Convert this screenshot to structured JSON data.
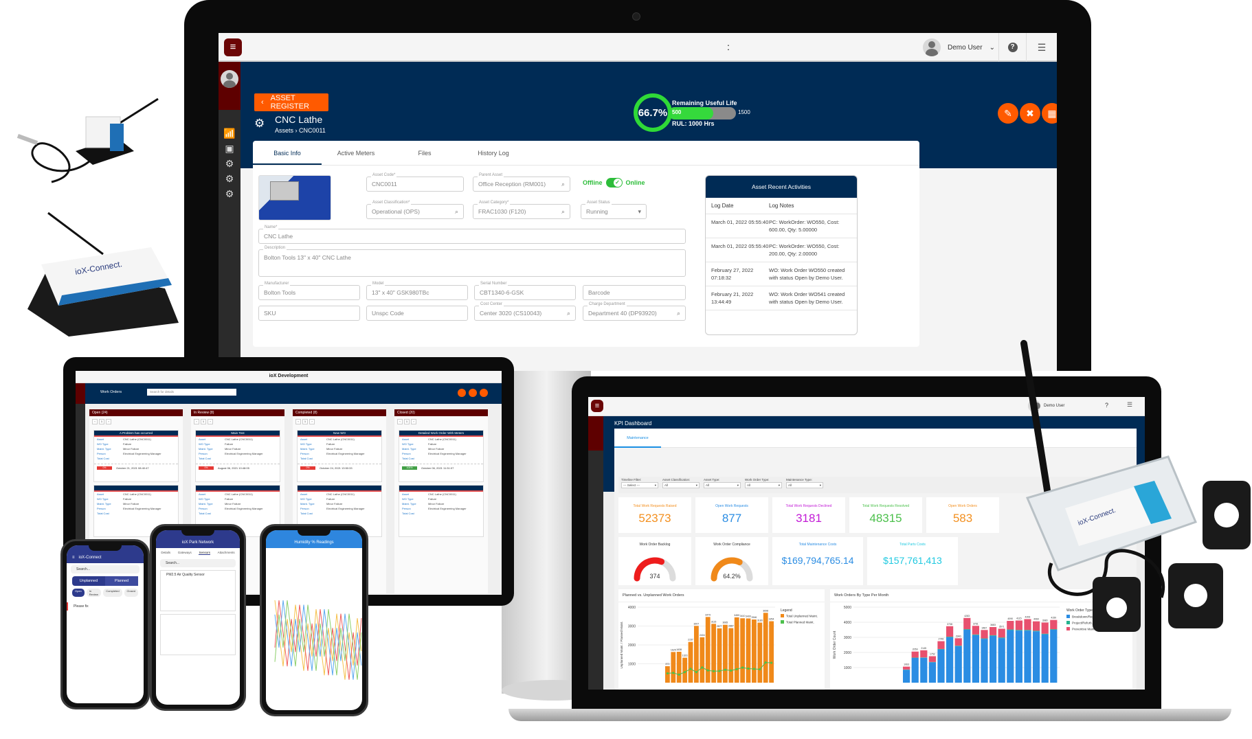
{
  "monitor": {
    "topbar": {
      "center_mark": ":",
      "user_name": "Demo User",
      "help_icon": "?",
      "menu_icon": "☰"
    },
    "back_button": "ASSET REGISTER",
    "asset": {
      "title": "CNC Lathe",
      "breadcrumb_root": "Assets",
      "breadcrumb_sep": "›",
      "breadcrumb_leaf": "CNC0011"
    },
    "rul": {
      "percent_label": "66.7%",
      "percent": 66.7,
      "title": "Remaining Useful Life",
      "min": "500",
      "max": "1500",
      "fill_fraction": 0.6667,
      "rul_text": "RUL: 1000 Hrs"
    },
    "tabs": [
      "Basic Info",
      "Active Meters",
      "Files",
      "History Log"
    ],
    "active_tab": "Basic Info",
    "form": {
      "asset_code": {
        "label": "Asset Code*",
        "value": "CNC0011"
      },
      "parent_asset": {
        "label": "Parent Asset",
        "value": "Office Reception  (RM001)"
      },
      "status_toggle": {
        "off_label": "Offline",
        "on_label": "Online",
        "state": "Online"
      },
      "asset_classification": {
        "label": "Asset Classification*",
        "value": "Operational (OPS)"
      },
      "asset_category": {
        "label": "Asset Category*",
        "value": "FRAC1030 (F120)"
      },
      "asset_status": {
        "label": "Asset Status",
        "value": "Running"
      },
      "name": {
        "label": "Name*",
        "value": "CNC Lathe"
      },
      "description": {
        "label": "Description",
        "value": "Bolton Tools 13\" x 40\" CNC Lathe"
      },
      "manufacturer": {
        "label": "Manufacturer",
        "value": "Bolton Tools"
      },
      "model": {
        "label": "Model",
        "value": "13\" x 40\" GSK980TBc"
      },
      "serial_number": {
        "label": "Serial Number",
        "value": "CBT1340-6-GSK"
      },
      "barcode": {
        "placeholder": "Barcode"
      },
      "sku": {
        "placeholder": "SKU"
      },
      "unspc_code": {
        "placeholder": "Unspc Code"
      },
      "cost_center": {
        "label": "Cost Center",
        "value": "Center 3020 (CS10043)"
      },
      "charge_department": {
        "label": "Charge Department",
        "value": "Department 40 (DP93920)"
      }
    },
    "activities": {
      "title": "Asset Recent Activities",
      "headers": [
        "Log Date",
        "Log Notes"
      ],
      "rows": [
        {
          "date": "March 01, 2022 05:55:40",
          "note": "PC: WorkOrder: WO550, Cost: 600.00, Qty: 5.00000"
        },
        {
          "date": "March 01, 2022 05:55:40",
          "note": "PC: WorkOrder: WO550, Cost: 200.00, Qty: 2.00000"
        },
        {
          "date": "February 27, 2022 07:18:32",
          "note": "WO: Work Order WO550 created with status Open by Demo User."
        },
        {
          "date": "February 21, 2022 13:44:49",
          "note": "WO: Work Order WO541 created with status Open by Demo User."
        }
      ]
    }
  },
  "tablet": {
    "title": "ioX Development",
    "section": "Work Orders",
    "search_placeholder": "Search for details",
    "columns": [
      {
        "title": "Open (24)",
        "card": "A Problem has occurred",
        "pill": "0%",
        "pill_color": "#e53935",
        "date": "October 21, 2021 08:40:47"
      },
      {
        "title": "In Review (8)",
        "card": "Main Test",
        "pill": "0%",
        "pill_color": "#e53935",
        "date": "August 06, 2021 10:48:05"
      },
      {
        "title": "Completed (8)",
        "card": "New WO",
        "pill": "0%",
        "pill_color": "#e53935",
        "date": "October 24, 2021 13:50:33"
      },
      {
        "title": "Closed (20)",
        "card": "Detailed Work Order With Meters",
        "pill": "100%",
        "pill_color": "#43a047",
        "date": "October 06, 2021 11:31:07"
      }
    ],
    "card_fields": [
      "Asset",
      "WO Type",
      "Maint. Type",
      "Person",
      "Total Cost"
    ],
    "card_values": [
      "CNC Lathe (CNC0011)",
      "Failure",
      "Minor Failure",
      "Electrical Engineering Manager"
    ]
  },
  "phones": [
    {
      "app": "ioX-Connect",
      "search": "Search...",
      "segments": [
        "Unplanned",
        "Planned"
      ],
      "chips": [
        "Open",
        "In Review",
        "Completed",
        "Closed"
      ],
      "item": "Please fix"
    },
    {
      "app": "ioX Park Network",
      "tabs": [
        "Details",
        "Gateways",
        "Sensors",
        "Attachments"
      ],
      "search": "Search...",
      "sensor_name": "PM2.5 Air Quality Sensor"
    },
    {
      "app": "Humidity % Readings"
    }
  ],
  "laptop": {
    "user_name": "Demo User",
    "title": "KPI Dashboard",
    "tab": "Maintenance",
    "filters": [
      {
        "label": "Timeline Filter:",
        "value": "--- Select ---"
      },
      {
        "label": "Asset Classification:",
        "value": "All"
      },
      {
        "label": "Asset Type:",
        "value": "All"
      },
      {
        "label": "Work Order Type:",
        "value": "All"
      },
      {
        "label": "Maintenance Type:",
        "value": "All"
      }
    ],
    "kpis": [
      {
        "title": "Total Work Requests Raised",
        "value": "52373",
        "color": "#f39020"
      },
      {
        "title": "Open Work Requests",
        "value": "877",
        "color": "#2b8de3"
      },
      {
        "title": "Total Work Requests Declined",
        "value": "3181",
        "color": "#c21bd6"
      },
      {
        "title": "Total Work Requests Resolved",
        "value": "48315",
        "color": "#4cc04c"
      },
      {
        "title": "Open Work Orders",
        "value": "583",
        "color": "#f39020"
      }
    ],
    "gauges": [
      {
        "title": "Work Order Backlog",
        "value": "374",
        "fraction": 0.62,
        "color": "#ee1c1c"
      },
      {
        "title": "Work Order Compliance",
        "value": "64.2%",
        "fraction": 0.642,
        "color": "#f0891a"
      }
    ],
    "costs": [
      {
        "title": "Total Maintenance Costs",
        "value": "$169,794,765.14",
        "color": "#2b8de3"
      },
      {
        "title": "Total Parts Costs",
        "value": "$157,761,413",
        "color": "#1fc9e0"
      }
    ]
  },
  "chart_data": [
    {
      "type": "bar",
      "title": "Planned vs. Unplanned Work Orders",
      "ylabel": "Unplanned Maint. / Planned Maint.",
      "ylim": [
        0,
        4000
      ],
      "yticks": [
        1000,
        2000,
        3000,
        4000
      ],
      "legend_title": "Legend",
      "legend_position": "top-right",
      "series": [
        {
          "name": "Total Unplanned Maint.",
          "kind": "bar",
          "color": "#f0891a",
          "values": [
            873,
            1625,
            1638,
            1323,
            2157,
            3007,
            2404,
            3479,
            3115,
            2877,
            3065,
            2887,
            3459,
            3410,
            3400,
            3346,
            3180,
            3698,
            3254
          ]
        },
        {
          "name": "Total Planned Maint.",
          "kind": "line",
          "color": "#4cc04c",
          "values": [
            494,
            520,
            429,
            560,
            731,
            560,
            804,
            650,
            610,
            619,
            684,
            640,
            715,
            800,
            745,
            727,
            707,
            1067,
            1053
          ]
        }
      ]
    },
    {
      "type": "bar",
      "stacked": true,
      "title": "Work Orders By Type Per Month",
      "ylabel": "Work Order Count",
      "ylim": [
        0,
        5000
      ],
      "yticks": [
        1000,
        2000,
        3000,
        4000,
        5000
      ],
      "legend_title": "Work Order Types",
      "legend_position": "right",
      "legend_entries": [
        "Breakdown/Repair Or...",
        "Project/Refurb...",
        "Preventive Maintenan..."
      ],
      "totals": [
        1063,
        2059,
        2145,
        1752,
        2746,
        3738,
        2940,
        4283,
        3761,
        3487,
        3683,
        3571,
        4090,
        4115,
        4206,
        4060,
        3980,
        4150
      ],
      "series": [
        {
          "name": "Breakdown",
          "color": "#2b8de3",
          "values": [
            850,
            1640,
            1650,
            1350,
            2200,
            3000,
            2420,
            3500,
            3150,
            2900,
            3100,
            2950,
            3480,
            3450,
            3450,
            3400,
            3200,
            3500
          ]
        },
        {
          "name": "Project",
          "color": "#26b38f",
          "values": [
            20,
            20,
            20,
            20,
            30,
            40,
            30,
            40,
            40,
            30,
            40,
            40,
            40,
            40,
            40,
            40,
            40,
            40
          ]
        },
        {
          "name": "Preventive",
          "color": "#e8506e",
          "values": [
            193,
            399,
            475,
            382,
            516,
            698,
            490,
            743,
            571,
            557,
            543,
            581,
            570,
            625,
            716,
            620,
            740,
            610
          ]
        }
      ]
    }
  ]
}
